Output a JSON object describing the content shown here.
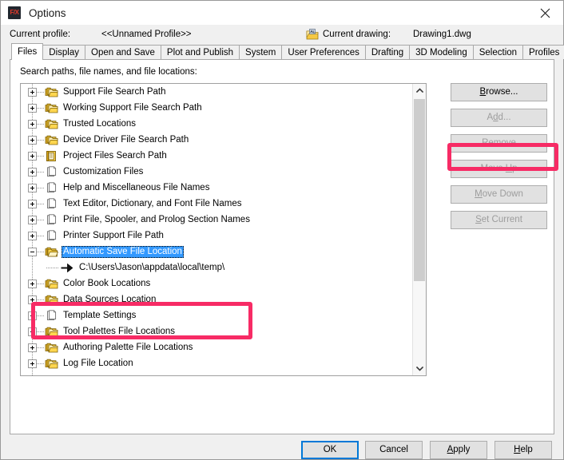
{
  "window": {
    "title": "Options",
    "app_icon": "landfx-logo-icon",
    "close_label": "✕"
  },
  "header": {
    "profile_label": "Current profile:",
    "profile_value": "<<Unnamed Profile>>",
    "drawing_icon": "drawing-file-icon",
    "drawing_label": "Current drawing:",
    "drawing_value": "Drawing1.dwg"
  },
  "tabs": [
    {
      "label": "Files",
      "active": true
    },
    {
      "label": "Display",
      "active": false
    },
    {
      "label": "Open and Save",
      "active": false
    },
    {
      "label": "Plot and Publish",
      "active": false
    },
    {
      "label": "System",
      "active": false
    },
    {
      "label": "User Preferences",
      "active": false
    },
    {
      "label": "Drafting",
      "active": false
    },
    {
      "label": "3D Modeling",
      "active": false
    },
    {
      "label": "Selection",
      "active": false
    },
    {
      "label": "Profiles",
      "active": false
    }
  ],
  "panel": {
    "caption": "Search paths, file names, and file locations:"
  },
  "tree": {
    "rows": [
      {
        "label": "Support File Search Path",
        "icon": "folder-stack-icon",
        "expander": "plus",
        "kind": "node",
        "selected": false
      },
      {
        "label": "Working Support File Search Path",
        "icon": "folder-stack-icon",
        "expander": "plus",
        "kind": "node",
        "selected": false
      },
      {
        "label": "Trusted Locations",
        "icon": "folder-stack-icon",
        "expander": "plus",
        "kind": "node",
        "selected": false
      },
      {
        "label": "Device Driver File Search Path",
        "icon": "folder-stack-icon",
        "expander": "plus",
        "kind": "node",
        "selected": false
      },
      {
        "label": "Project Files Search Path",
        "icon": "project-book-icon",
        "expander": "plus",
        "kind": "node",
        "selected": false
      },
      {
        "label": "Customization Files",
        "icon": "document-stack-icon",
        "expander": "plus",
        "kind": "node",
        "selected": false
      },
      {
        "label": "Help and Miscellaneous File Names",
        "icon": "document-stack-icon",
        "expander": "plus",
        "kind": "node",
        "selected": false
      },
      {
        "label": "Text Editor, Dictionary, and Font File Names",
        "icon": "document-stack-icon",
        "expander": "plus",
        "kind": "node",
        "selected": false
      },
      {
        "label": "Print File, Spooler, and Prolog Section Names",
        "icon": "document-stack-icon",
        "expander": "plus",
        "kind": "node",
        "selected": false
      },
      {
        "label": "Printer Support File Path",
        "icon": "document-stack-icon",
        "expander": "plus",
        "kind": "node",
        "selected": false
      },
      {
        "label": "Automatic Save File Location",
        "icon": "folder-open-icon",
        "expander": "minus",
        "kind": "node",
        "selected": true
      },
      {
        "label": "C:\\Users\\Jason\\appdata\\local\\temp\\",
        "icon": "arrow-right-icon",
        "expander": "none",
        "kind": "value",
        "selected": false
      },
      {
        "label": "Color Book Locations",
        "icon": "folder-stack-icon",
        "expander": "plus",
        "kind": "node",
        "selected": false
      },
      {
        "label": "Data Sources Location",
        "icon": "folder-stack-icon",
        "expander": "plus",
        "kind": "node",
        "selected": false
      },
      {
        "label": "Template Settings",
        "icon": "document-stack-icon",
        "expander": "plus",
        "kind": "node",
        "selected": false
      },
      {
        "label": "Tool Palettes File Locations",
        "icon": "folder-stack-icon",
        "expander": "plus",
        "kind": "node",
        "selected": false
      },
      {
        "label": "Authoring Palette File Locations",
        "icon": "folder-stack-icon",
        "expander": "plus",
        "kind": "node",
        "selected": false
      },
      {
        "label": "Log File Location",
        "icon": "folder-stack-icon",
        "expander": "plus",
        "kind": "node",
        "selected": false
      }
    ]
  },
  "side_buttons": [
    {
      "label": "Browse...",
      "accel": "B",
      "disabled": false
    },
    {
      "label": "Add...",
      "accel": "d",
      "disabled": true
    },
    {
      "label": "Remove",
      "accel": "R",
      "disabled": true
    },
    {
      "label": "Move Up",
      "accel": "U",
      "disabled": true
    },
    {
      "label": "Move Down",
      "accel": "M",
      "disabled": true
    },
    {
      "label": "Set Current",
      "accel": "S",
      "disabled": true
    }
  ],
  "footer_buttons": {
    "ok": "OK",
    "cancel": "Cancel",
    "apply": "Apply",
    "help": "Help"
  },
  "highlights": {
    "color": "#f72b65",
    "targets": [
      "browse-button",
      "automatic-save-file-location-row"
    ]
  },
  "colors": {
    "selection_blue": "#3399ff",
    "default_button_border": "#0078d7",
    "dialog_bg": "#f0f0f0",
    "folder_yellow": "#ffd64f"
  }
}
